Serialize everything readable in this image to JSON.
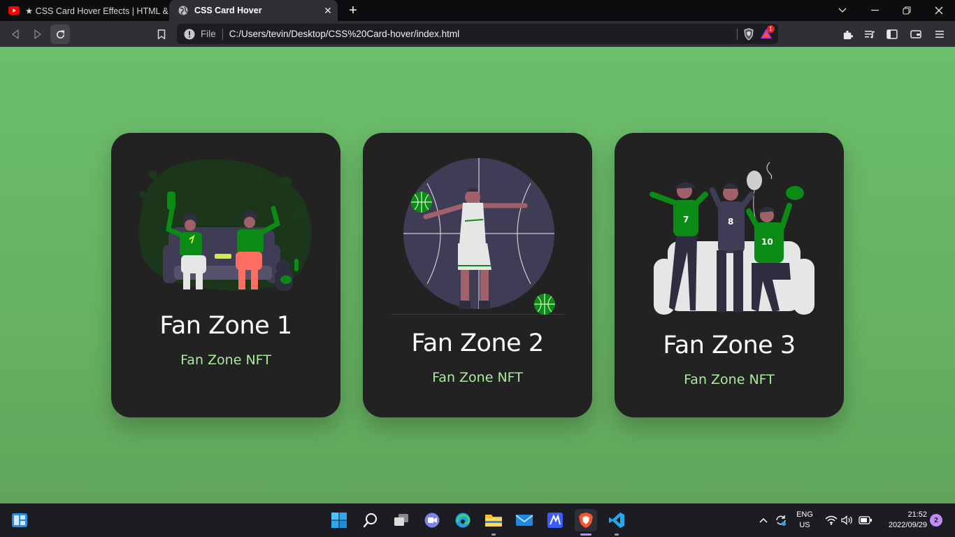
{
  "browser": {
    "tabs": [
      {
        "title": "★ CSS Card Hover Effects | HTML & CSS",
        "favicon": "youtube-icon",
        "active": false
      },
      {
        "title": "CSS Card Hover",
        "favicon": "globe-icon",
        "active": true
      }
    ],
    "close_symbol": "✕",
    "new_tab_symbol": "+",
    "address": {
      "scheme_label": "File",
      "url": "C:/Users/tevin/Desktop/CSS%20Card-hover/index.html"
    },
    "brave_rewards_count": "1"
  },
  "page": {
    "cards": [
      {
        "title": "Fan Zone 1",
        "subtitle": "Fan Zone NFT"
      },
      {
        "title": "Fan Zone 2",
        "subtitle": "Fan Zone NFT"
      },
      {
        "title": "Fan Zone 3",
        "subtitle": "Fan Zone NFT"
      }
    ],
    "colors": {
      "background": "#68b866",
      "card": "#222222",
      "subtitle": "#a9ec9d",
      "accent_green": "#0b8a16"
    }
  },
  "taskbar": {
    "language": {
      "line1": "ENG",
      "line2": "US"
    },
    "clock": {
      "time": "21:52",
      "date": "2022/09/29"
    },
    "notifications": "2",
    "pinned": [
      "widgets-icon",
      "start-icon",
      "search-icon",
      "task-view-icon",
      "chat-icon",
      "edge-icon",
      "file-explorer-icon",
      "mail-icon",
      "app-icon",
      "brave-icon",
      "vscode-icon"
    ]
  }
}
